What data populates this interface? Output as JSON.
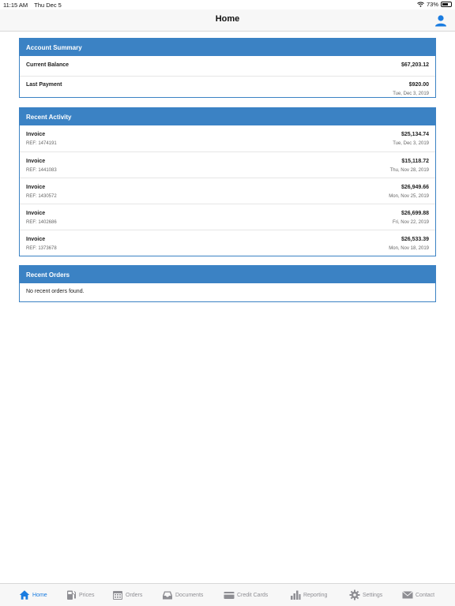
{
  "status": {
    "time": "11:15 AM",
    "date": "Thu Dec 5",
    "battery": "73%",
    "battery_level": 0.73
  },
  "header": {
    "title": "Home"
  },
  "account_summary": {
    "title": "Account Summary",
    "rows": [
      {
        "label": "Current Balance",
        "amount": "$67,203.12",
        "date": ""
      },
      {
        "label": "Last Payment",
        "amount": "$920.00",
        "date": "Tue, Dec 3, 2019"
      }
    ]
  },
  "recent_activity": {
    "title": "Recent Activity",
    "items": [
      {
        "type": "Invoice",
        "ref": "REF: 1474191",
        "amount": "$25,134.74",
        "date": "Tue, Dec 3, 2019"
      },
      {
        "type": "Invoice",
        "ref": "REF: 1441083",
        "amount": "$15,118.72",
        "date": "Thu, Nov 28, 2019"
      },
      {
        "type": "Invoice",
        "ref": "REF: 1430572",
        "amount": "$26,949.66",
        "date": "Mon, Nov 25, 2019"
      },
      {
        "type": "Invoice",
        "ref": "REF: 1402686",
        "amount": "$26,699.88",
        "date": "Fri, Nov 22, 2019"
      },
      {
        "type": "Invoice",
        "ref": "REF: 1373678",
        "amount": "$26,533.39",
        "date": "Mon, Nov 18, 2019"
      }
    ]
  },
  "recent_orders": {
    "title": "Recent Orders",
    "empty_message": "No recent orders found."
  },
  "tabs": [
    {
      "label": "Home",
      "icon": "home-icon",
      "active": true
    },
    {
      "label": "Prices",
      "icon": "fuel-pump-icon",
      "active": false
    },
    {
      "label": "Orders",
      "icon": "calendar-icon",
      "active": false
    },
    {
      "label": "Documents",
      "icon": "inbox-icon",
      "active": false
    },
    {
      "label": "Credit Cards",
      "icon": "credit-card-icon",
      "active": false
    },
    {
      "label": "Reporting",
      "icon": "bar-chart-icon",
      "active": false
    },
    {
      "label": "Settings",
      "icon": "gear-icon",
      "active": false
    },
    {
      "label": "Contact",
      "icon": "envelope-icon",
      "active": false
    }
  ],
  "colors": {
    "accent": "#3b82c4",
    "tab_active": "#1a7ce0",
    "tab_inactive": "#8e8e93"
  }
}
